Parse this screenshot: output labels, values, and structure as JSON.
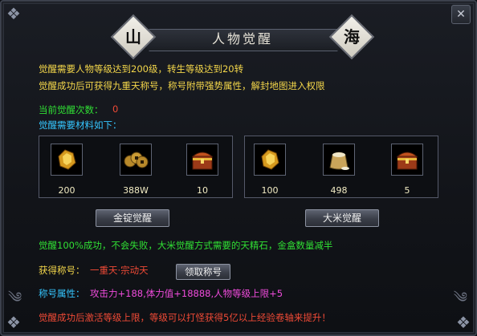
{
  "window": {
    "title": "人物觉醒",
    "seal_left": "山",
    "seal_right": "海",
    "close_icon": "close-icon"
  },
  "requirements": {
    "line1": "觉醒需要人物等级达到200级，转生等级达到20转",
    "line2": "觉醒成功后可获得九重天称号，称号附带强势属性，解封地图进入权限"
  },
  "status": {
    "count_label": "当前觉醒次数：",
    "count_value": "0",
    "materials_label": "觉醒需要材料如下："
  },
  "left_materials": [
    {
      "icon": "gold-ore-icon",
      "qty": "200"
    },
    {
      "icon": "coins-icon",
      "qty": "388W"
    },
    {
      "icon": "treasure-chest-icon",
      "qty": "10"
    }
  ],
  "right_materials": [
    {
      "icon": "gold-ore-icon",
      "qty": "100"
    },
    {
      "icon": "rice-sack-icon",
      "qty": "498"
    },
    {
      "icon": "treasure-chest-icon",
      "qty": "5"
    }
  ],
  "buttons": {
    "gold_awaken": "金锭觉醒",
    "rice_awaken": "大米觉醒",
    "claim_title": "领取称号"
  },
  "notes": {
    "success_info": "觉醒100%成功，不会失败，大米觉醒方式需要的天精石，金盒数量减半",
    "obtained_label": "获得称号：",
    "obtained_value": "一重天·宗动天",
    "attr_label": "称号属性：",
    "attr_value": "攻击力+188,体力值+18888,人物等级上限+5",
    "footer": "觉醒成功后激活等级上限，等级可以打怪获得5亿以上经验卷轴来提升！"
  },
  "colors": {
    "yellow": "#f3d64a",
    "green": "#30df34",
    "red": "#f04a36",
    "cyan": "#35c6ff",
    "magenta": "#f04bdc"
  }
}
